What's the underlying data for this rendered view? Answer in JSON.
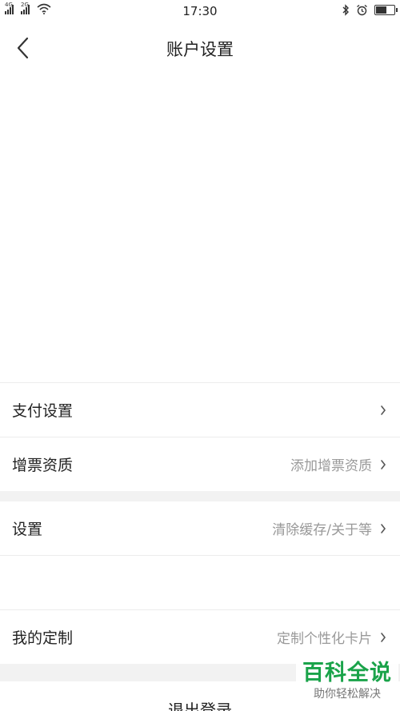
{
  "status_bar": {
    "signal_1_tag": "4G",
    "signal_2_tag": "2G",
    "time": "17:30",
    "battery_level": 0.6
  },
  "nav": {
    "title": "账户设置"
  },
  "rows": {
    "payment": {
      "label": "支付设置",
      "value": ""
    },
    "invoice": {
      "label": "增票资质",
      "value": "添加增票资质"
    },
    "settings": {
      "label": "设置",
      "value": "清除缓存/关于等"
    },
    "custom": {
      "label": "我的定制",
      "value": "定制个性化卡片"
    }
  },
  "logout_label": "退出登录",
  "watermark": {
    "title": "百科全说",
    "subtitle": "助你轻松解决"
  },
  "colors": {
    "brand_green": "#1aa34a",
    "section_gap": "#f2f2f2",
    "secondary_text": "#999999"
  }
}
